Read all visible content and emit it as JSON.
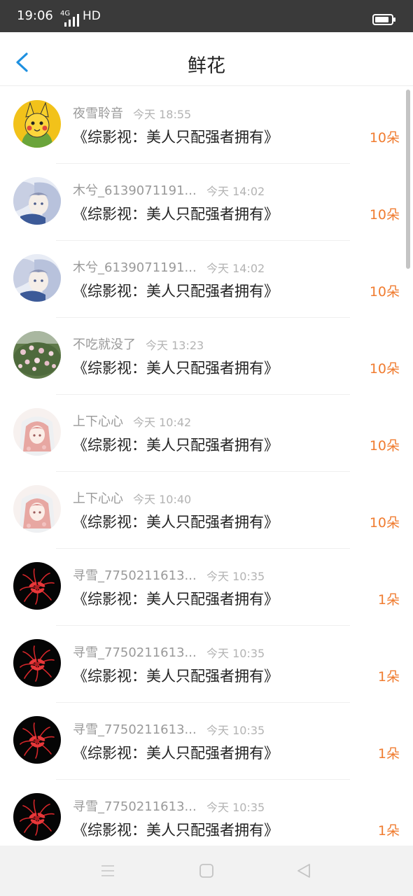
{
  "status_bar": {
    "time": "19:06",
    "network": "4G",
    "hd": "HD"
  },
  "header": {
    "title": "鲜花"
  },
  "colors": {
    "accent_blue": "#1e90e0",
    "count_orange": "#f07c30"
  },
  "records": [
    {
      "user": "夜雪聆音",
      "time": "今天 18:55",
      "book": "《综影视：美人只配强者拥有》",
      "count": "10朵",
      "avatar": "pikachu"
    },
    {
      "user": "木兮_6139071191...",
      "time": "今天 14:02",
      "book": "《综影视：美人只配强者拥有》",
      "count": "10朵",
      "avatar": "anime-girl-blue"
    },
    {
      "user": "木兮_6139071191...",
      "time": "今天 14:02",
      "book": "《综影视：美人只配强者拥有》",
      "count": "10朵",
      "avatar": "anime-girl-blue"
    },
    {
      "user": "不吃就没了",
      "time": "今天 13:23",
      "book": "《综影视：美人只配强者拥有》",
      "count": "10朵",
      "avatar": "flower-bush"
    },
    {
      "user": "上下心心",
      "time": "今天 10:42",
      "book": "《综影视：美人只配强者拥有》",
      "count": "10朵",
      "avatar": "anime-girl-pink"
    },
    {
      "user": "上下心心",
      "time": "今天 10:40",
      "book": "《综影视：美人只配强者拥有》",
      "count": "10朵",
      "avatar": "anime-girl-pink"
    },
    {
      "user": "寻雪_7750211613...",
      "time": "今天 10:35",
      "book": "《综影视：美人只配强者拥有》",
      "count": "1朵",
      "avatar": "red-spider-lily"
    },
    {
      "user": "寻雪_7750211613...",
      "time": "今天 10:35",
      "book": "《综影视：美人只配强者拥有》",
      "count": "1朵",
      "avatar": "red-spider-lily"
    },
    {
      "user": "寻雪_7750211613...",
      "time": "今天 10:35",
      "book": "《综影视：美人只配强者拥有》",
      "count": "1朵",
      "avatar": "red-spider-lily"
    },
    {
      "user": "寻雪_7750211613...",
      "time": "今天 10:35",
      "book": "《综影视：美人只配强者拥有》",
      "count": "1朵",
      "avatar": "red-spider-lily"
    }
  ]
}
